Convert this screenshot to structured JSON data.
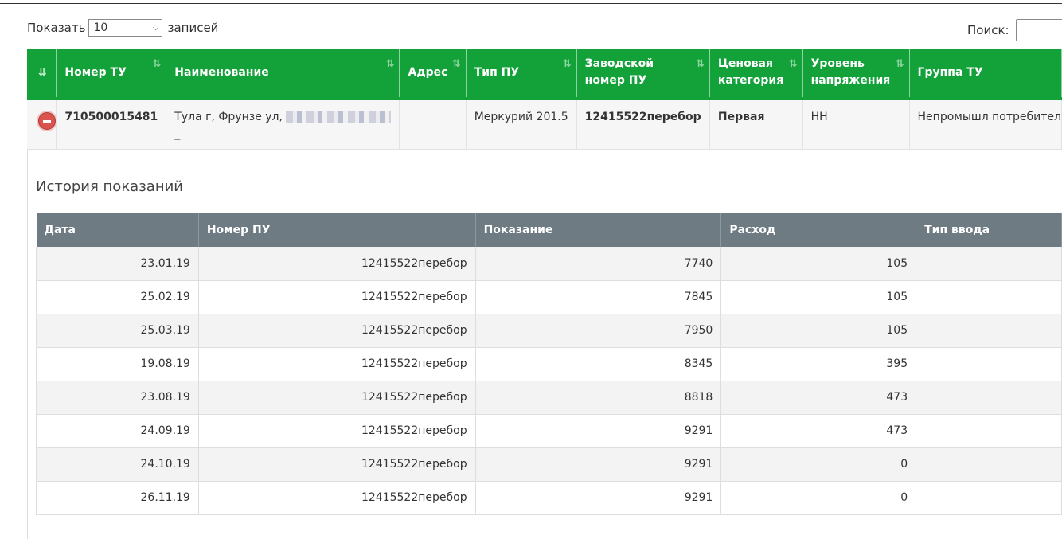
{
  "length": {
    "prefix": "Показать",
    "value": "10",
    "suffix": "записей"
  },
  "search": {
    "label": "Поиск:"
  },
  "main_table": {
    "columns": [
      {
        "label": ""
      },
      {
        "label": "Номер ТУ"
      },
      {
        "label": "Наименование"
      },
      {
        "label": "Адрес"
      },
      {
        "label": "Тип ПУ"
      },
      {
        "label": "Заводской номер ПУ"
      },
      {
        "label": "Ценовая категория"
      },
      {
        "label": "Уровень напряжения"
      },
      {
        "label": "Группа ТУ"
      }
    ],
    "row": {
      "number": "710500015481",
      "name": "Тула г, Фрунзе ул,",
      "name_line2": "_",
      "address": "",
      "meter_type": "Меркурий 201.5",
      "serial": "12415522перебор",
      "price_category": "Первая",
      "voltage": "НН",
      "group": "Непромышл потребител"
    }
  },
  "history": {
    "title": "История показаний",
    "columns": [
      "Дата",
      "Номер ПУ",
      "Показание",
      "Расход",
      "Тип ввода"
    ],
    "rows": [
      [
        "23.01.19",
        "12415522перебор",
        "7740",
        "105",
        ""
      ],
      [
        "25.02.19",
        "12415522перебор",
        "7845",
        "105",
        ""
      ],
      [
        "25.03.19",
        "12415522перебор",
        "7950",
        "105",
        ""
      ],
      [
        "19.08.19",
        "12415522перебор",
        "8345",
        "395",
        ""
      ],
      [
        "23.08.19",
        "12415522перебор",
        "8818",
        "473",
        ""
      ],
      [
        "24.09.19",
        "12415522перебор",
        "9291",
        "473",
        ""
      ],
      [
        "24.10.19",
        "12415522перебор",
        "9291",
        "0",
        ""
      ],
      [
        "26.11.19",
        "12415522перебор",
        "9291",
        "0",
        ""
      ]
    ]
  },
  "colors": {
    "header_green": "#13a139",
    "history_header": "#6e7b83",
    "remove_red": "#d9534f"
  }
}
